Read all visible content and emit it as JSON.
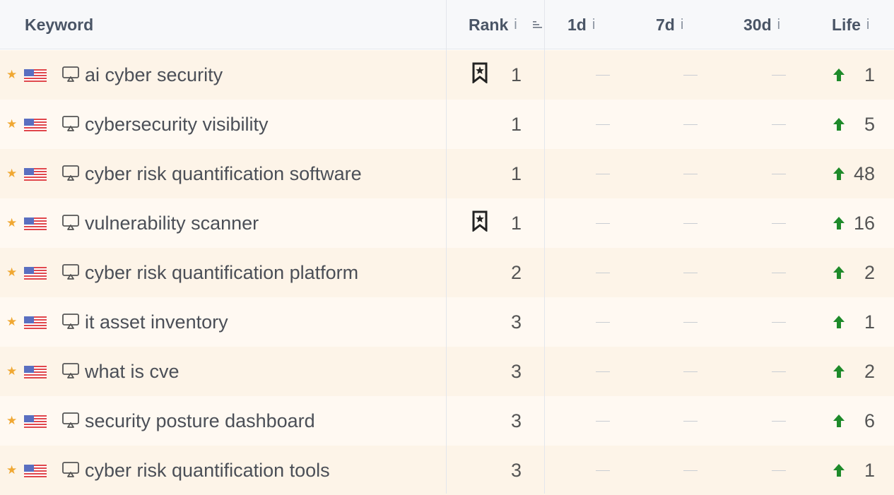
{
  "header": {
    "keyword": "Keyword",
    "rank": "Rank",
    "d1": "1d",
    "d7": "7d",
    "d30": "30d",
    "life": "Life",
    "info": "i"
  },
  "empty_value": "—",
  "colors": {
    "star": "#f0a833",
    "arrow_up": "#1e8a2a",
    "row_a": "#fdf4e8",
    "row_b": "#fff9f2"
  },
  "rows": [
    {
      "keyword": "ai cyber security",
      "rank": "1",
      "bookmarked": true,
      "d1": "",
      "d7": "",
      "d30": "",
      "life": "1"
    },
    {
      "keyword": "cybersecurity visibility",
      "rank": "1",
      "bookmarked": false,
      "d1": "",
      "d7": "",
      "d30": "",
      "life": "5"
    },
    {
      "keyword": "cyber risk quantification software",
      "rank": "1",
      "bookmarked": false,
      "d1": "",
      "d7": "",
      "d30": "",
      "life": "48"
    },
    {
      "keyword": "vulnerability scanner",
      "rank": "1",
      "bookmarked": true,
      "d1": "",
      "d7": "",
      "d30": "",
      "life": "16"
    },
    {
      "keyword": "cyber risk quantification platform",
      "rank": "2",
      "bookmarked": false,
      "d1": "",
      "d7": "",
      "d30": "",
      "life": "2"
    },
    {
      "keyword": "it asset inventory",
      "rank": "3",
      "bookmarked": false,
      "d1": "",
      "d7": "",
      "d30": "",
      "life": "1"
    },
    {
      "keyword": "what is cve",
      "rank": "3",
      "bookmarked": false,
      "d1": "",
      "d7": "",
      "d30": "",
      "life": "2"
    },
    {
      "keyword": "security posture dashboard",
      "rank": "3",
      "bookmarked": false,
      "d1": "",
      "d7": "",
      "d30": "",
      "life": "6"
    },
    {
      "keyword": "cyber risk quantification tools",
      "rank": "3",
      "bookmarked": false,
      "d1": "",
      "d7": "",
      "d30": "",
      "life": "1"
    }
  ]
}
